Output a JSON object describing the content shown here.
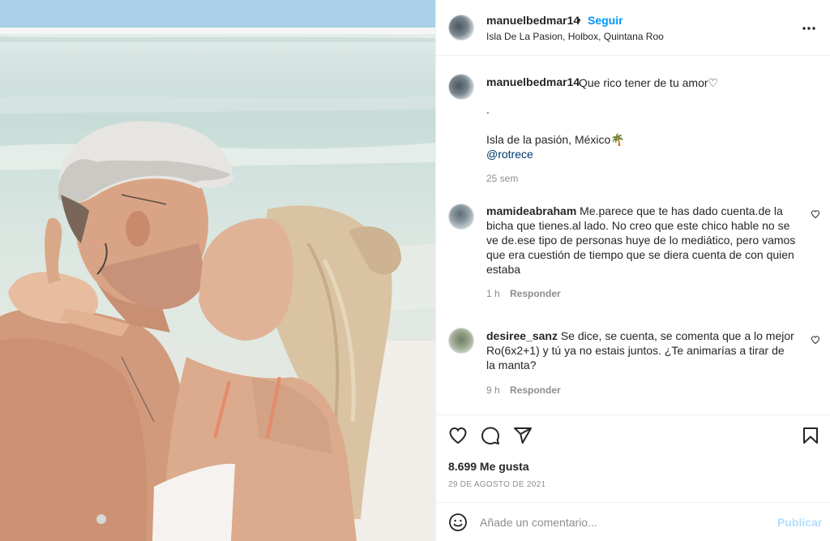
{
  "post": {
    "author": "manuelbedmar14",
    "follow_label": "Seguir",
    "separator": "•",
    "location": "Isla De La Pasion, Holbox, Quintana Roo",
    "more_icon": "more-horizontal-icon"
  },
  "caption": {
    "author": "manuelbedmar14",
    "text": "Que rico tener de tu amor♡",
    "dot_line": ".",
    "place_line": "Isla de la pasión, México🌴",
    "mention": "@rotrece",
    "time": "25 sem"
  },
  "comments": [
    {
      "author": "mamideabraham",
      "text": "Me.parece que te has dado cuenta.de la bicha que tienes.al lado. No creo que este chico hable no se ve de.ese tipo de personas huye de lo mediático, pero vamos que era cuestión de tiempo que se diera cuenta de con quien estaba",
      "time": "1 h",
      "reply_label": "Responder"
    },
    {
      "author": "desiree_sanz",
      "text": "Se dice, se cuenta, se comenta que a lo mejor Ro(6x2+1) y tú ya no estais juntos. ¿Te animarías a tirar de la manta?",
      "time": "9 h",
      "reply_label": "Responder"
    }
  ],
  "engagement": {
    "likes": "8.699 Me gusta",
    "date": "29 DE AGOSTO DE 2021"
  },
  "composer": {
    "placeholder": "Añade un comentario...",
    "publish_label": "Publicar",
    "emoji_icon": "emoji-icon"
  },
  "colors": {
    "accent": "#0095f6",
    "publish_disabled": "#b2dffc",
    "muted": "#8e8e8e",
    "link": "#00376b"
  }
}
